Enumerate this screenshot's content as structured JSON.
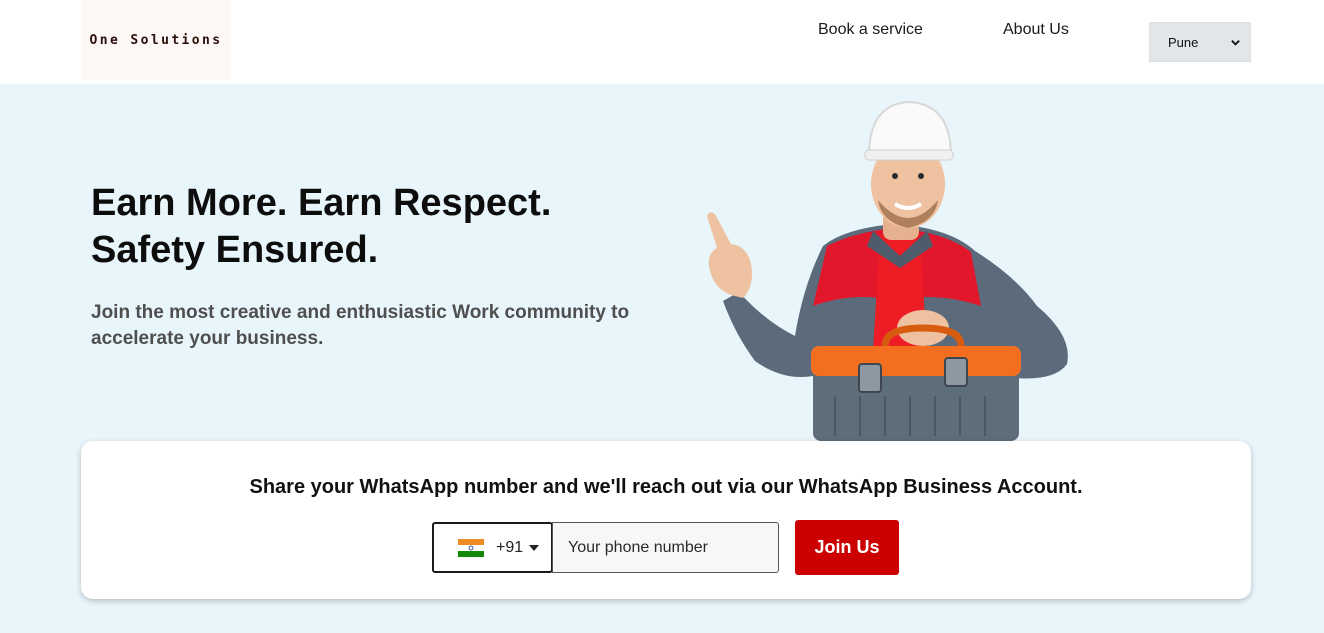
{
  "header": {
    "logo_text": "One Solutions",
    "nav": {
      "book_service": "Book a service",
      "about_us": "About Us"
    },
    "city_select": {
      "selected": "Pune"
    }
  },
  "hero": {
    "title_line1": "Earn More. Earn Respect.",
    "title_line2": "Safety Ensured.",
    "subtitle": "Join the most creative and enthusiastic Work community to accelerate your business.",
    "image_icon": "worker-with-toolbox-illustration"
  },
  "signup_card": {
    "title": "Share your WhatsApp number and we'll reach out via our WhatsApp Business Account.",
    "country": {
      "flag_icon": "india-flag-icon",
      "dial_code": "+91"
    },
    "phone": {
      "value": "",
      "placeholder": "Your phone number"
    },
    "join_label": "Join Us"
  },
  "colors": {
    "hero_background": "#e8f5fb",
    "accent_red": "#cc0000",
    "select_background": "#e3e6e8"
  }
}
